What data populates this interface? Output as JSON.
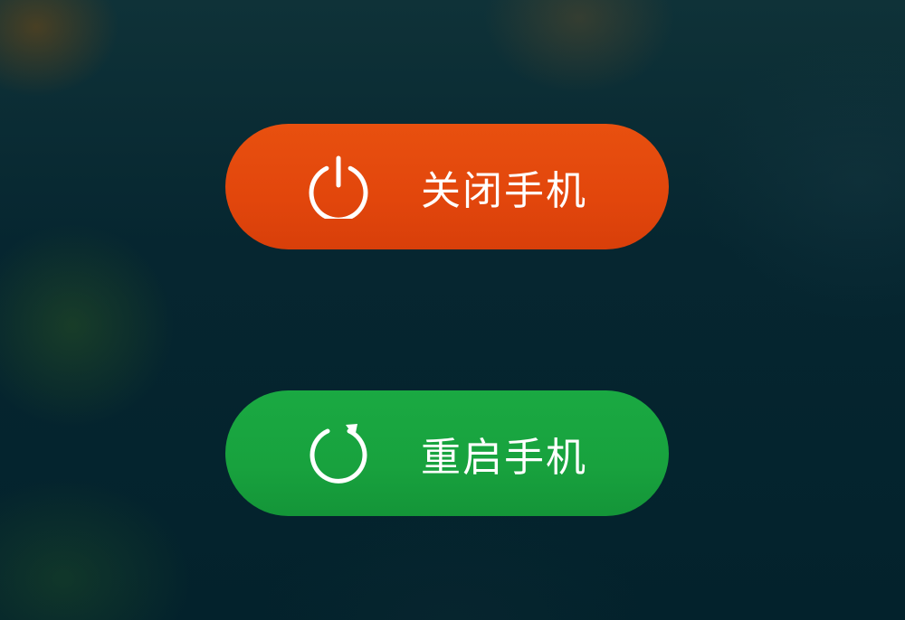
{
  "power_menu": {
    "power_off": {
      "label": "关闭手机",
      "icon": "power-icon",
      "color": "#e2460c"
    },
    "restart": {
      "label": "重启手机",
      "icon": "restart-icon",
      "color": "#18a23e"
    }
  }
}
